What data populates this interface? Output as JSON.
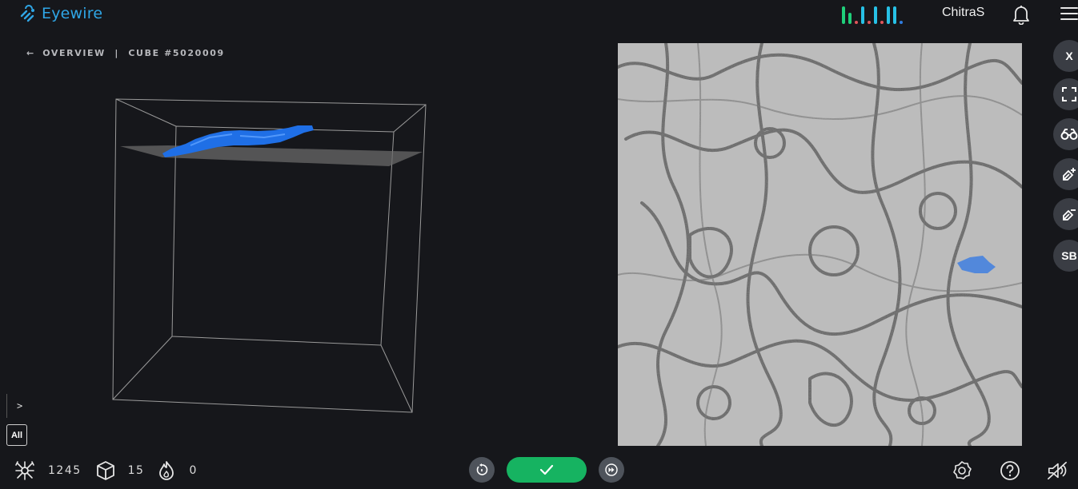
{
  "app": {
    "logo_text": "Eyewire",
    "username": "ChitraS",
    "activity_bars": [
      {
        "color": "#1fcf7a",
        "height": 22
      },
      {
        "color": "#1fcf7a",
        "height": 14
      },
      {
        "color": "#e0555b",
        "height": 4
      },
      {
        "color": "#27c1e6",
        "height": 22
      },
      {
        "color": "#e0555b",
        "height": 4
      },
      {
        "color": "#27c1e6",
        "height": 22
      },
      {
        "color": "#e0555b",
        "height": 4
      },
      {
        "color": "#27c1e6",
        "height": 22
      },
      {
        "color": "#27c1e6",
        "height": 22
      },
      {
        "color": "#2f7de0",
        "height": 4
      }
    ]
  },
  "breadcrumb": {
    "back_arrow": "←",
    "overview_label": "OVERVIEW",
    "separator": "|",
    "cube_label": "CUBE #5020009"
  },
  "side_toolbar": {
    "close_label": "X",
    "sb_label": "SB",
    "icons": [
      "fullscreen-icon",
      "binoculars-icon",
      "highlight-add-icon",
      "highlight-remove-icon"
    ]
  },
  "left_panel": {
    "expand_label": ">",
    "filter_label": "All"
  },
  "stats": {
    "cubes_traced": "1245",
    "cubes_today": "15",
    "streak": "0"
  },
  "colors": {
    "accent": "#2fa6e6",
    "submit": "#16b361",
    "segment": "#1f6fe6",
    "background": "#16171b"
  },
  "bottom_right_icons": [
    "settings-icon",
    "help-icon",
    "sound-icon"
  ]
}
